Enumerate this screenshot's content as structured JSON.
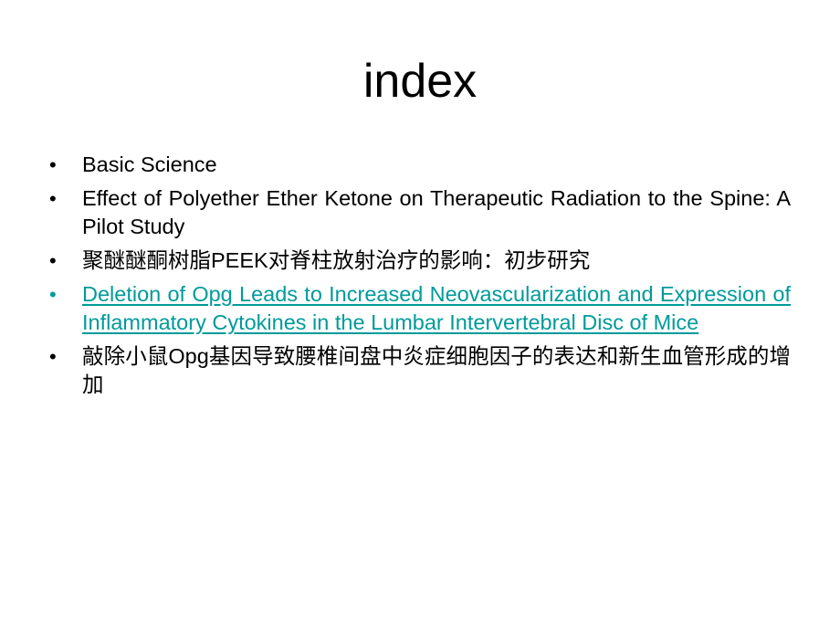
{
  "slide": {
    "title": "index",
    "bullet_glyph": "•",
    "bullets": [
      {
        "text": "Basic Science",
        "type": "text"
      },
      {
        "text": "Effect of Polyether Ether Ketone on Therapeutic Radiation to the Spine: A Pilot Study",
        "type": "text"
      },
      {
        "text": "聚醚醚酮树脂PEEK对脊柱放射治疗的影响：初步研究",
        "type": "text"
      },
      {
        "text": "Deletion of Opg Leads to Increased Neovascularization and Expression of Inflammatory Cytokines in the Lumbar Intervertebral Disc of Mice",
        "type": "link"
      },
      {
        "text": "敲除小鼠Opg基因导致腰椎间盘中炎症细胞因子的表达和新生血管形成的增加",
        "type": "text"
      }
    ]
  },
  "colors": {
    "link": "#009a9a",
    "text": "#000000",
    "background": "#ffffff"
  }
}
